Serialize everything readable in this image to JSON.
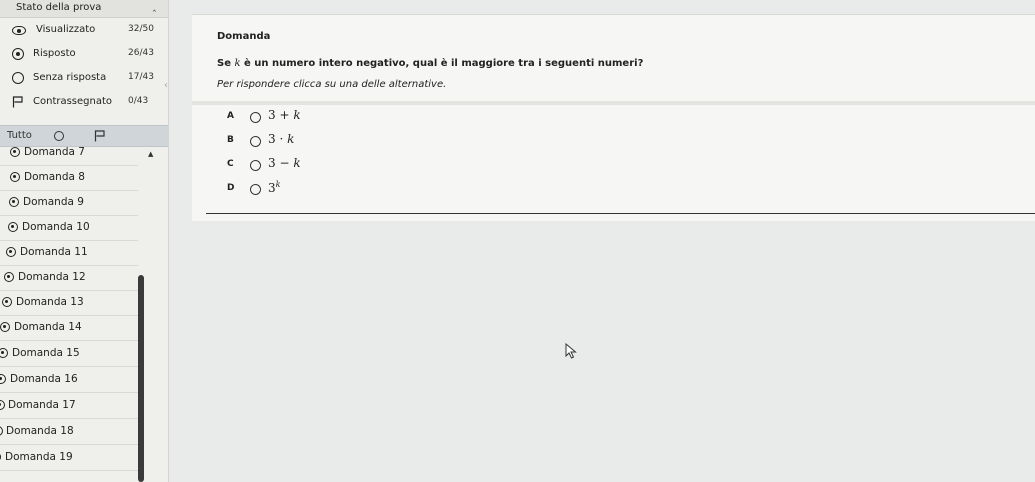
{
  "sidebar": {
    "title": "Stato della prova",
    "collapse_icon": "chevron-up-icon",
    "stats": [
      {
        "label": "Visualizzato",
        "value": "32/50",
        "icon": "eye-icon"
      },
      {
        "label": "Risposto",
        "value": "26/43",
        "icon": "radio-filled-icon"
      },
      {
        "label": "Senza risposta",
        "value": "17/43",
        "icon": "radio-empty-icon"
      },
      {
        "label": "Contrassegnato",
        "value": "0/43",
        "icon": "flag-icon"
      }
    ],
    "filter": {
      "all_label": "Tutto"
    },
    "questions": [
      {
        "label": "Domanda 7"
      },
      {
        "label": "Domanda 8"
      },
      {
        "label": "Domanda 9"
      },
      {
        "label": "Domanda 10"
      },
      {
        "label": "Domanda 11"
      },
      {
        "label": "Domanda 12"
      },
      {
        "label": "Domanda 13"
      },
      {
        "label": "Domanda 14"
      },
      {
        "label": "Domanda 15"
      },
      {
        "label": "Domanda 16"
      },
      {
        "label": "Domanda 17"
      },
      {
        "label": "Domanda 18"
      },
      {
        "label": "Domanda 19"
      }
    ]
  },
  "question": {
    "heading": "Domanda",
    "text_before": "Se ",
    "variable": "k",
    "text_after": " è un numero intero negativo, qual è il maggiore tra i seguenti numeri?",
    "instruction": "Per rispondere clicca su una delle alternative.",
    "options": [
      {
        "letter": "A",
        "left": "3 + ",
        "var": "k"
      },
      {
        "letter": "B",
        "left": "3 · ",
        "var": "k"
      },
      {
        "letter": "C",
        "left": "3 − ",
        "var": "k"
      },
      {
        "letter": "D",
        "left": "3",
        "sup": "k"
      }
    ]
  }
}
